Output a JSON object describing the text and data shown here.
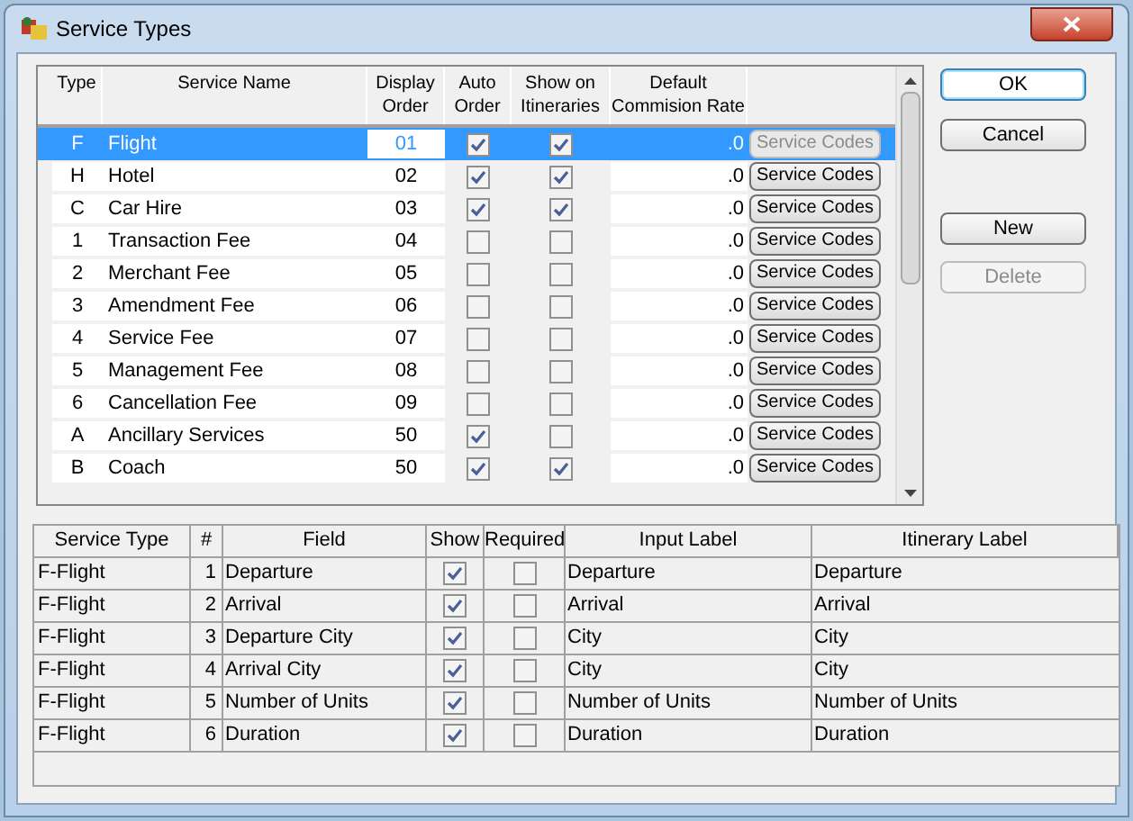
{
  "window": {
    "title": "Service Types"
  },
  "services": {
    "columns": [
      "Type",
      "Service Name",
      "Display Order",
      "Auto Order",
      "Show on Itineraries",
      "Default Commision Rate"
    ],
    "rows": [
      {
        "type": "F",
        "name": "Flight",
        "order": "01",
        "auto_order": true,
        "show_on_itineraries": true,
        "rate": ".0",
        "codes_button": "Service Codes",
        "selected": true
      },
      {
        "type": "H",
        "name": "Hotel",
        "order": "02",
        "auto_order": true,
        "show_on_itineraries": true,
        "rate": ".0",
        "codes_button": "Service Codes",
        "selected": false
      },
      {
        "type": "C",
        "name": "Car Hire",
        "order": "03",
        "auto_order": true,
        "show_on_itineraries": true,
        "rate": ".0",
        "codes_button": "Service Codes",
        "selected": false
      },
      {
        "type": "1",
        "name": "Transaction Fee",
        "order": "04",
        "auto_order": false,
        "show_on_itineraries": false,
        "rate": ".0",
        "codes_button": "Service Codes",
        "selected": false
      },
      {
        "type": "2",
        "name": "Merchant Fee",
        "order": "05",
        "auto_order": false,
        "show_on_itineraries": false,
        "rate": ".0",
        "codes_button": "Service Codes",
        "selected": false
      },
      {
        "type": "3",
        "name": "Amendment Fee",
        "order": "06",
        "auto_order": false,
        "show_on_itineraries": false,
        "rate": ".0",
        "codes_button": "Service Codes",
        "selected": false
      },
      {
        "type": "4",
        "name": "Service Fee",
        "order": "07",
        "auto_order": false,
        "show_on_itineraries": false,
        "rate": ".0",
        "codes_button": "Service Codes",
        "selected": false
      },
      {
        "type": "5",
        "name": "Management Fee",
        "order": "08",
        "auto_order": false,
        "show_on_itineraries": false,
        "rate": ".0",
        "codes_button": "Service Codes",
        "selected": false
      },
      {
        "type": "6",
        "name": "Cancellation Fee",
        "order": "09",
        "auto_order": false,
        "show_on_itineraries": false,
        "rate": ".0",
        "codes_button": "Service Codes",
        "selected": false
      },
      {
        "type": "A",
        "name": "Ancillary Services",
        "order": "50",
        "auto_order": true,
        "show_on_itineraries": false,
        "rate": ".0",
        "codes_button": "Service Codes",
        "selected": false
      },
      {
        "type": "B",
        "name": "Coach",
        "order": "50",
        "auto_order": true,
        "show_on_itineraries": true,
        "rate": ".0",
        "codes_button": "Service Codes",
        "selected": false
      }
    ]
  },
  "buttons": [
    {
      "label": "OK",
      "default": true,
      "disabled": false
    },
    {
      "label": "Cancel",
      "default": false,
      "disabled": false
    },
    {
      "label": "New",
      "default": false,
      "disabled": false
    },
    {
      "label": "Delete",
      "default": false,
      "disabled": true
    }
  ],
  "fields": {
    "columns": [
      "Service Type",
      "#",
      "Field",
      "Show",
      "Required",
      "Input Label",
      "Itinerary Label"
    ],
    "rows": [
      {
        "service_type": "F-Flight",
        "number": "1",
        "field": "Departure",
        "show": true,
        "required": false,
        "input_label": "Departure",
        "itinerary_label": "Departure"
      },
      {
        "service_type": "F-Flight",
        "number": "2",
        "field": "Arrival",
        "show": true,
        "required": false,
        "input_label": "Arrival",
        "itinerary_label": "Arrival"
      },
      {
        "service_type": "F-Flight",
        "number": "3",
        "field": "Departure City",
        "show": true,
        "required": false,
        "input_label": "City",
        "itinerary_label": "City"
      },
      {
        "service_type": "F-Flight",
        "number": "4",
        "field": "Arrival City",
        "show": true,
        "required": false,
        "input_label": "City",
        "itinerary_label": "City"
      },
      {
        "service_type": "F-Flight",
        "number": "5",
        "field": "Number of Units",
        "show": true,
        "required": false,
        "input_label": "Number of Units",
        "itinerary_label": "Number of Units"
      },
      {
        "service_type": "F-Flight",
        "number": "6",
        "field": "Duration",
        "show": true,
        "required": false,
        "input_label": "Duration",
        "itinerary_label": "Duration"
      }
    ]
  }
}
